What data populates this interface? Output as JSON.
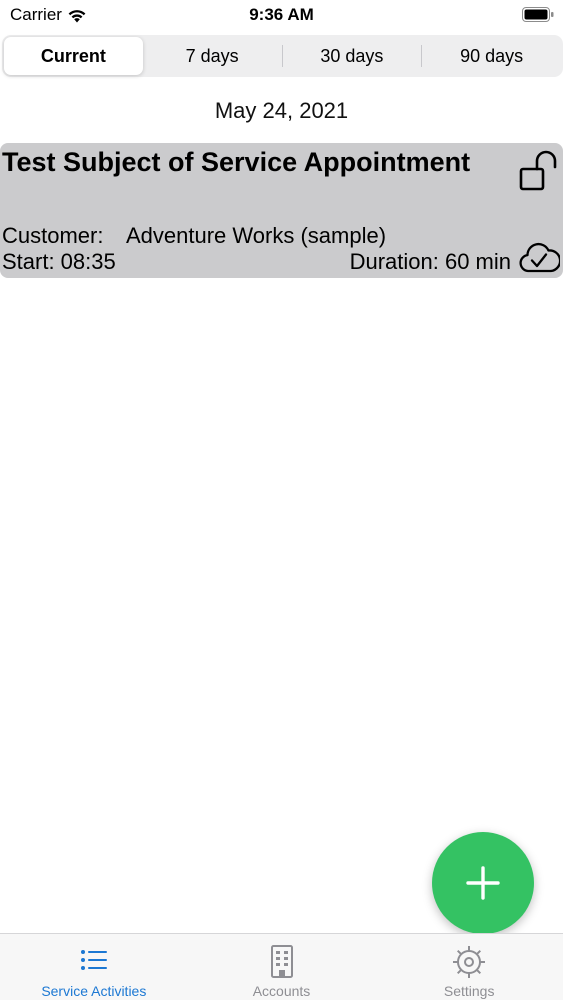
{
  "status_bar": {
    "carrier": "Carrier",
    "time": "9:36 AM"
  },
  "segments": {
    "items": [
      {
        "label": "Current",
        "selected": true
      },
      {
        "label": "7 days",
        "selected": false
      },
      {
        "label": "30 days",
        "selected": false
      },
      {
        "label": "90 days",
        "selected": false
      }
    ]
  },
  "list": {
    "date": "May 24, 2021",
    "appointment": {
      "title": "Test Subject of Service Appointment",
      "customer_label": "Customer:",
      "customer_value": "Adventure Works (sample)",
      "start": "Start: 08:35",
      "duration": "Duration: 60 min",
      "lock_icon": "unlock-icon",
      "sync_icon": "cloud-check-icon"
    }
  },
  "fab": {
    "icon": "plus-icon",
    "color": "#34c263"
  },
  "tab_bar": {
    "active_color": "#1c78d3",
    "inactive_color": "#8e8e93",
    "items": [
      {
        "label": "Service Activities",
        "icon": "list-icon",
        "active": true
      },
      {
        "label": "Accounts",
        "icon": "building-icon",
        "active": false
      },
      {
        "label": "Settings",
        "icon": "gear-icon",
        "active": false
      }
    ]
  }
}
